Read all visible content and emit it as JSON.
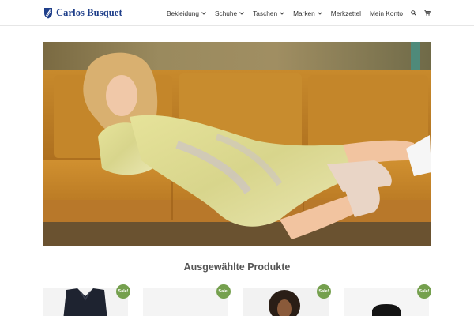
{
  "brand": {
    "name": "Carlos Busquet"
  },
  "nav": {
    "items": [
      {
        "label": "Bekleidung",
        "has_dropdown": true
      },
      {
        "label": "Schuhe",
        "has_dropdown": true
      },
      {
        "label": "Taschen",
        "has_dropdown": true
      },
      {
        "label": "Marken",
        "has_dropdown": true
      },
      {
        "label": "Merkzettel",
        "has_dropdown": false
      },
      {
        "label": "Mein Konto",
        "has_dropdown": false
      }
    ],
    "icons": [
      "search-icon",
      "cart-icon"
    ]
  },
  "featured": {
    "title": "Ausgewählte Produkte",
    "badge_label": "Sale!",
    "products": [
      {
        "image": "dark-blazer-image",
        "sale": true
      },
      {
        "image": "light-garment-image",
        "sale": true
      },
      {
        "image": "curly-hair-model-image",
        "sale": true
      },
      {
        "image": "black-boot-image",
        "sale": true
      }
    ]
  },
  "colors": {
    "brand_blue": "#1f3f8a",
    "sale_green": "#75a04e",
    "header_border": "#e6e6e6"
  }
}
